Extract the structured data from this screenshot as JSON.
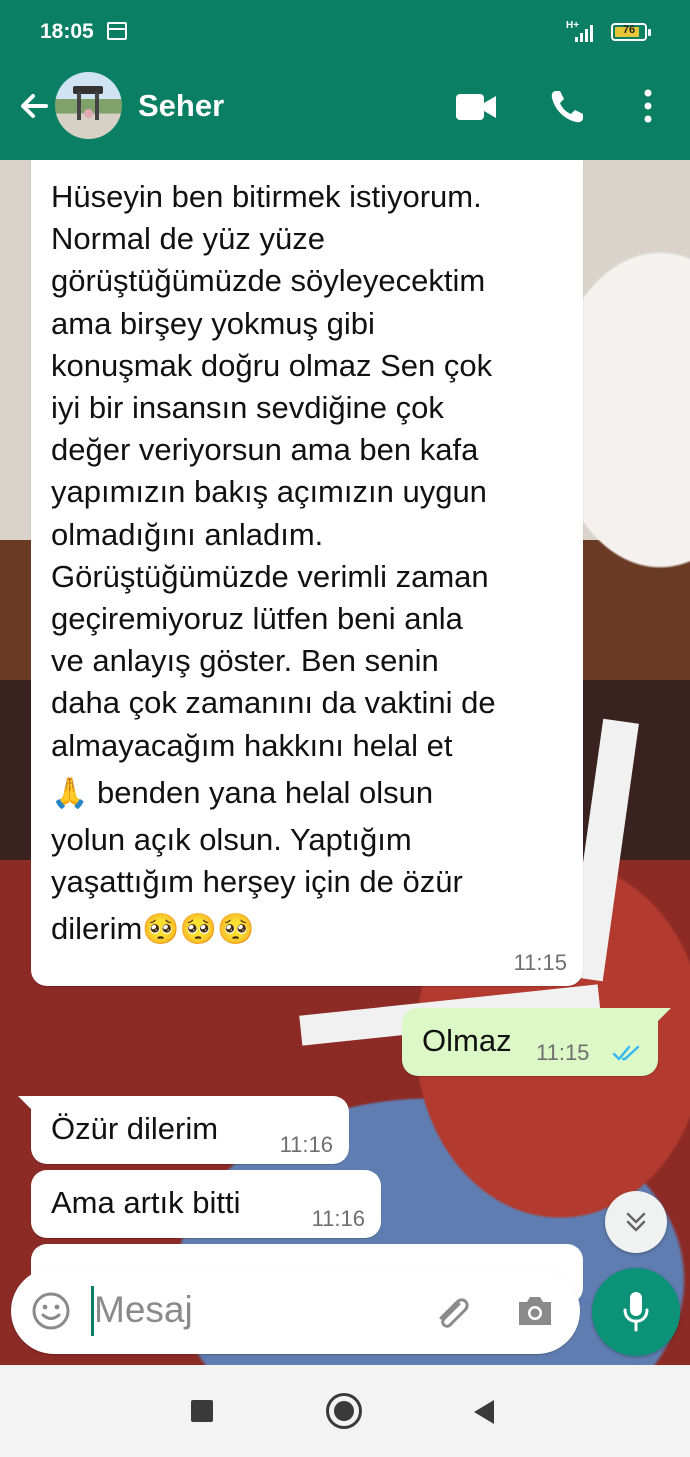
{
  "status_bar": {
    "time": "18:05",
    "network": "H+",
    "battery": "76"
  },
  "header": {
    "contact_name": "Seher"
  },
  "messages": [
    {
      "direction": "in",
      "lines": [
        "Hüseyin ben bitirmek istiyorum.",
        "Normal de yüz yüze",
        "görüştüğümüzde söyleyecektim",
        "ama birşey yokmuş gibi",
        "konuşmak doğru olmaz Sen çok",
        "iyi bir insansın sevdiğine çok",
        "değer veriyorsun ama ben kafa",
        "yapımızın bakış açımızın uygun",
        "olmadığını anladım.",
        "Görüştüğümüzde verimli zaman",
        "geçiremiyoruz lütfen beni anla",
        "ve anlayış göster. Ben senin",
        "daha çok zamanını da vaktini de",
        "almayacağım hakkını helal et"
      ],
      "emoji_prayer": "🙏",
      "line_after_emoji": "benden yana helal olsun",
      "lines_tail": [
        "yolun açık olsun. Yaptığım",
        "yaşattığım herşey için de özür"
      ],
      "last_line": "dilerim",
      "emoji_tail": "🥺🥺🥺",
      "time": "11:15"
    },
    {
      "direction": "out",
      "text": "Olmaz",
      "time": "11:15",
      "status": "read"
    },
    {
      "direction": "in",
      "text": "Özür dilerim",
      "time": "11:16"
    },
    {
      "direction": "in",
      "text": "Ama artık bitti",
      "time": "11:16"
    }
  ],
  "composer": {
    "placeholder": "Mesaj"
  },
  "colors": {
    "header": "#0b7f63",
    "outgoing": "#dcf8c6",
    "incoming": "#ffffff",
    "read_ticks": "#34b7f1",
    "fab": "#0b9277"
  }
}
